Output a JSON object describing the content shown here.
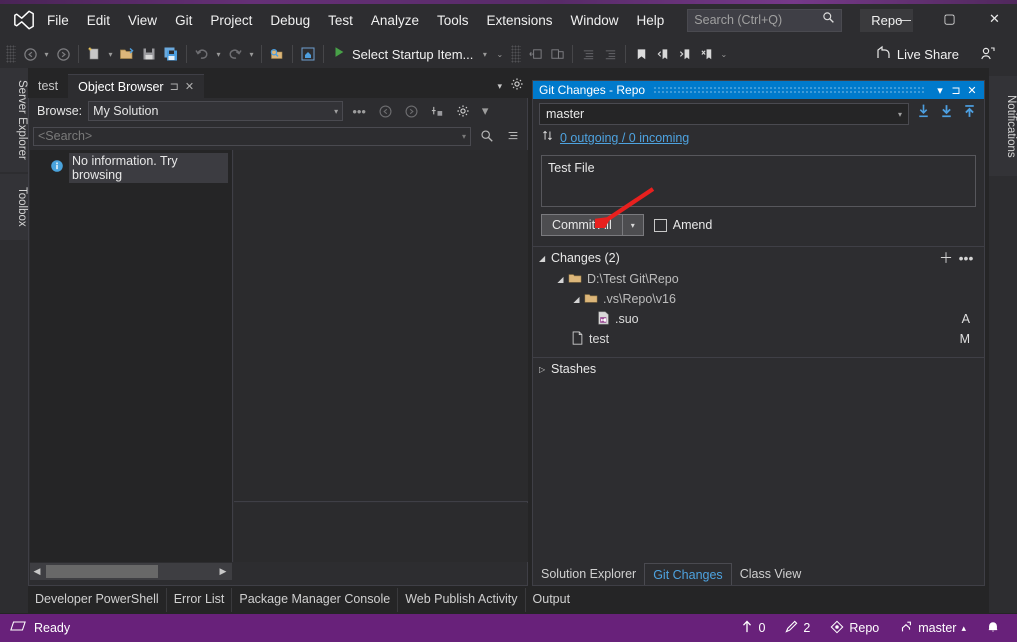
{
  "window": {
    "menu": [
      "File",
      "Edit",
      "View",
      "Git",
      "Project",
      "Debug",
      "Test",
      "Analyze",
      "Tools",
      "Extensions",
      "Window",
      "Help"
    ],
    "search_placeholder": "Search (Ctrl+Q)",
    "solution_chip": "Repo",
    "minimize": "—",
    "maximize": "▢",
    "close": "✕",
    "logo_icon": "visual-studio-logo"
  },
  "toolbar": {
    "startup_label": "Select Startup Item...",
    "live_share_label": "Live Share",
    "icons": {
      "navigate_back": "back-arrow-icon",
      "navigate_forward": "forward-arrow-icon",
      "new_project": "new-project-icon",
      "open_file": "open-folder-icon",
      "save": "save-icon",
      "save_all": "save-all-icon",
      "undo": "undo-icon",
      "redo": "redo-icon",
      "find": "find-in-files-icon",
      "home": "home-icon",
      "run": "run-play-icon",
      "bookmark": "bookmark-icon",
      "live_share": "live-share-icon",
      "account": "account-icon"
    }
  },
  "left_dock": {
    "tabs": [
      "Server Explorer",
      "Toolbox"
    ]
  },
  "right_dock": {
    "tabs": [
      "Notifications"
    ]
  },
  "object_browser": {
    "tabs": [
      {
        "label": "test",
        "active": false
      },
      {
        "label": "Object Browser",
        "active": true
      }
    ],
    "browse_label": "Browse:",
    "browse_value": "My Solution",
    "search_placeholder": "<Search>",
    "no_info_text": "No information. Try browsing",
    "icons": {
      "back": "back-circle-icon",
      "forward": "forward-circle-icon",
      "add_ref": "add-reference-icon",
      "settings": "gear-icon",
      "search": "search-icon",
      "filter": "filter-list-icon",
      "info": "info-icon",
      "tab_menu": "chevron-down-icon",
      "tab_settings": "gear-icon",
      "pin": "pin-icon",
      "close": "close-icon"
    }
  },
  "bottom_tabs": [
    "Developer PowerShell",
    "Error List",
    "Package Manager Console",
    "Web Publish Activity",
    "Output"
  ],
  "git_changes": {
    "title": "Git Changes - Repo",
    "branch": "master",
    "sync_status": "0 outgoing / 0 incoming",
    "commit_message": "Test File",
    "commit_button": "Commit All",
    "amend_label": "Amend",
    "changes_header": "Changes (2)",
    "tree": [
      {
        "indent": 1,
        "label": "D:\\Test Git\\Repo",
        "icon": "folder-icon",
        "expander": "expanded",
        "status": ""
      },
      {
        "indent": 2,
        "label": ".vs\\Repo\\v16",
        "icon": "folder-icon",
        "expander": "expanded",
        "status": ""
      },
      {
        "indent": 3,
        "label": ".suo",
        "icon": "vs-file-icon",
        "expander": "none",
        "status": "A"
      },
      {
        "indent": 2,
        "label": "test",
        "icon": "file-icon",
        "expander": "none",
        "status": "M"
      }
    ],
    "stashes_label": "Stashes",
    "panel_tabs": [
      {
        "label": "Solution Explorer",
        "active": false
      },
      {
        "label": "Git Changes",
        "active": true
      },
      {
        "label": "Class View",
        "active": false
      }
    ],
    "icons": {
      "fetch": "fetch-icon",
      "pull": "pull-down-icon",
      "push": "push-up-icon",
      "sync": "sync-arrows-icon",
      "add": "plus-icon",
      "more": "ellipsis-icon",
      "dropdown": "chevron-down-icon",
      "pin": "pin-icon",
      "close": "close-icon"
    }
  },
  "annotation": {
    "type": "red-arrow",
    "points_to": "Commit All",
    "color": "#e8201e"
  },
  "status_bar": {
    "ready_text": "Ready",
    "outgoing_count": "0",
    "changes_count": "2",
    "repo_name": "Repo",
    "branch_name": "master",
    "icons": {
      "status": "source-control-status-icon",
      "outgoing": "up-arrow-icon",
      "changes": "pencil-icon",
      "repo": "git-repo-icon",
      "branch": "branch-icon",
      "branch_caret": "caret-up-icon",
      "notifications": "bell-icon"
    },
    "background": "#68217a"
  },
  "colors": {
    "accent_blue": "#007acc",
    "purple_status": "#68217a",
    "panel_bg": "#2d2d30",
    "link_blue": "#4ea3e0",
    "red_arrow": "#e8201e"
  }
}
